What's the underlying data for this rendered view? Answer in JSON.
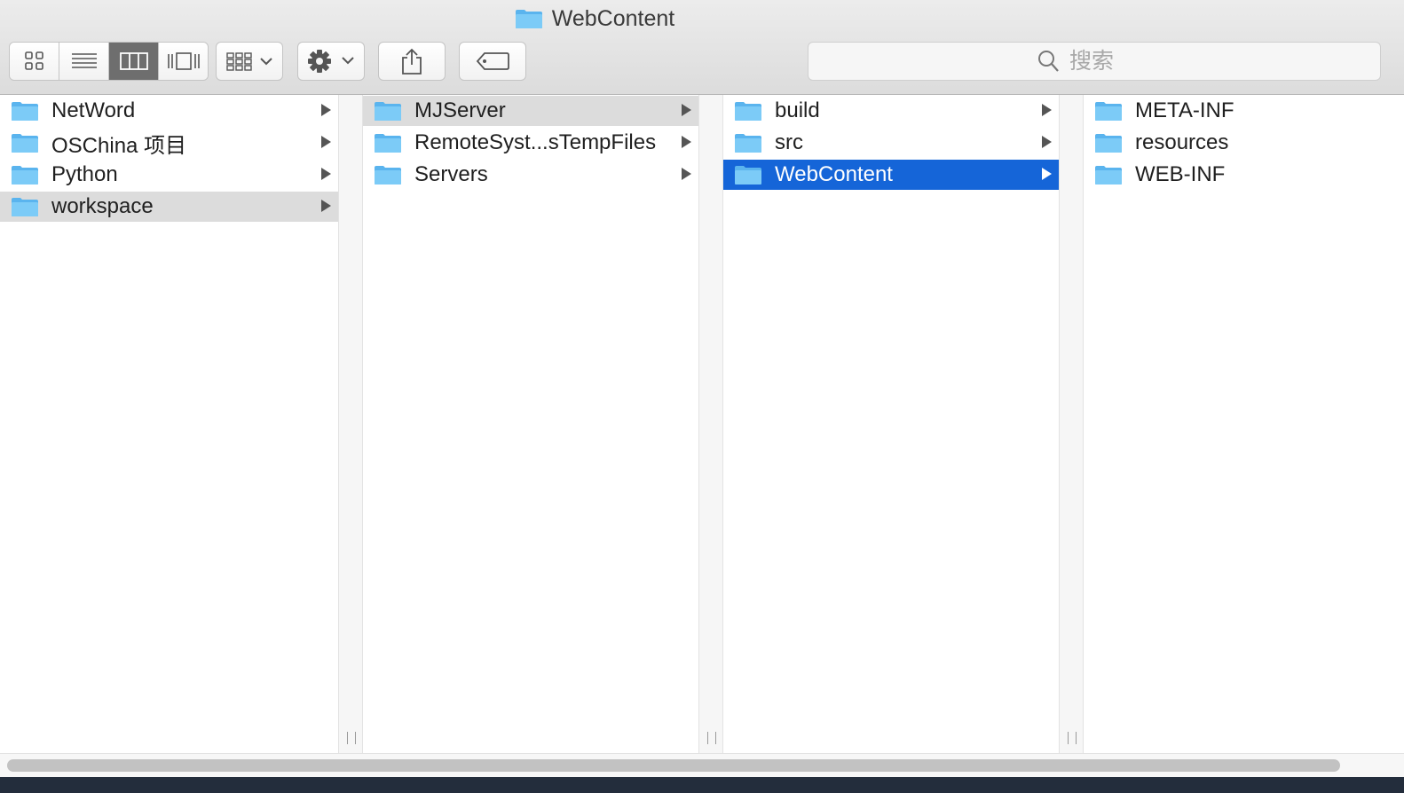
{
  "window": {
    "title": "WebContent"
  },
  "toolbar": {
    "view_buttons": [
      "icon-view",
      "list-view",
      "column-view",
      "cover-flow-view"
    ],
    "active_view": "column-view",
    "search": {
      "placeholder": "搜索",
      "value": ""
    }
  },
  "columns": [
    {
      "items": [
        {
          "label": "NetWord",
          "state": "normal",
          "has_children": true
        },
        {
          "label": "OSChina 项目",
          "state": "normal",
          "has_children": true
        },
        {
          "label": "Python",
          "state": "normal",
          "has_children": true
        },
        {
          "label": "workspace",
          "state": "selected-inactive",
          "has_children": true
        }
      ]
    },
    {
      "items": [
        {
          "label": "MJServer",
          "state": "selected-inactive",
          "has_children": true
        },
        {
          "label": "RemoteSyst...sTempFiles",
          "state": "normal",
          "has_children": true
        },
        {
          "label": "Servers",
          "state": "normal",
          "has_children": true
        }
      ]
    },
    {
      "items": [
        {
          "label": "build",
          "state": "normal",
          "has_children": true
        },
        {
          "label": "src",
          "state": "normal",
          "has_children": true
        },
        {
          "label": "WebContent",
          "state": "selected-active",
          "has_children": true
        }
      ]
    },
    {
      "items": [
        {
          "label": "META-INF",
          "state": "normal",
          "has_children": false
        },
        {
          "label": "resources",
          "state": "normal",
          "has_children": false
        },
        {
          "label": "WEB-INF",
          "state": "normal",
          "has_children": false
        }
      ]
    }
  ],
  "colors": {
    "selection_active": "#1565d8",
    "selection_inactive": "#dcdcdc",
    "folder": "#6fc3f5"
  }
}
